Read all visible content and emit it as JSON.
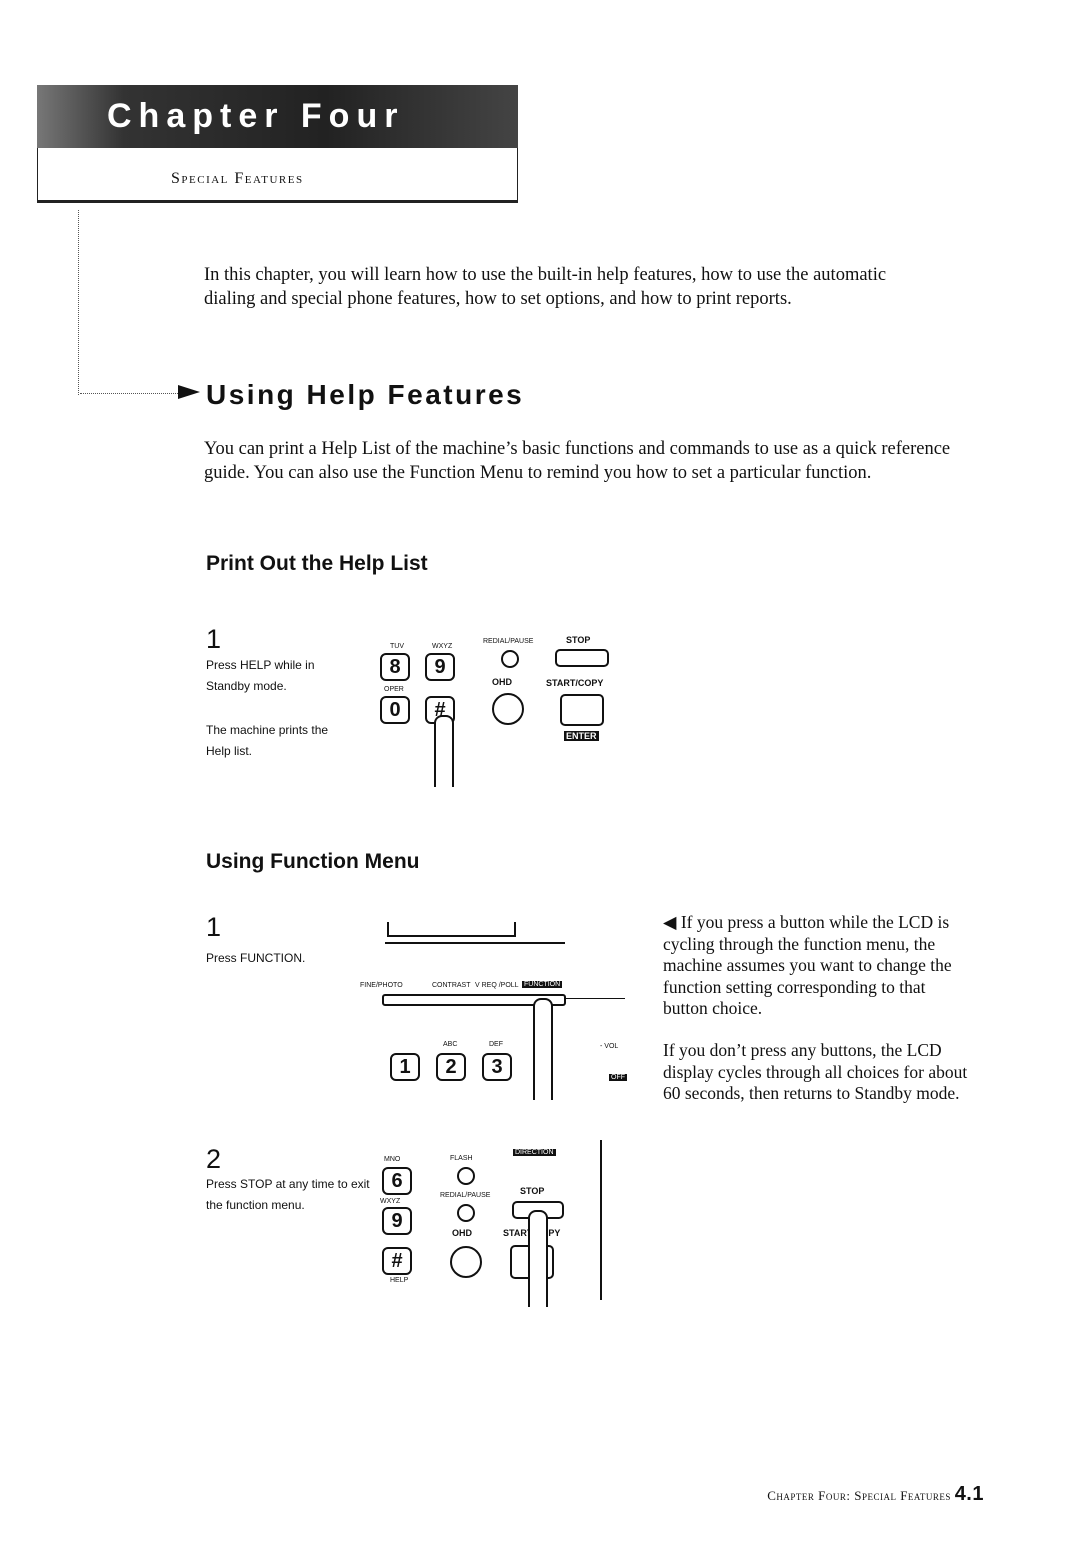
{
  "header": {
    "chapter": "Chapter Four",
    "subtitle": "Special Features"
  },
  "intro": "In this chapter, you will learn how to use the built-in help features, how to use the automatic dialing and special phone features, how to set options, and how to print reports.",
  "section": {
    "title": "Using Help Features",
    "body": "You can print a Help List of the machine’s basic functions and commands to use as a quick reference guide. You can also use the Function Menu to remind you how to set a particular function."
  },
  "help_list": {
    "title": "Print Out the Help List",
    "step_number": "1",
    "step_text_1": "Press HELP while in Standby mode.",
    "step_text_2": "The machine prints the Help list.",
    "panel": {
      "keys": [
        "8",
        "9",
        "0",
        "#"
      ],
      "key_labels": [
        "TUV",
        "WXYZ",
        "OPER"
      ],
      "redial": "REDIAL/PAUSE",
      "ohd": "OHD",
      "stop": "STOP",
      "start": "START/COPY",
      "enter": "ENTER"
    }
  },
  "function_menu": {
    "title": "Using Function Menu",
    "step1_number": "1",
    "step1_text": "Press FUNCTION.",
    "step2_number": "2",
    "step2_text": "Press STOP at any time to exit the function menu.",
    "panel1": {
      "buttons": [
        "FINE/PHOTO",
        "CONTRAST",
        "V REQ /POLL",
        "FUNCTION"
      ],
      "keys": [
        "1",
        "2",
        "3"
      ],
      "key_labels": [
        "ABC",
        "DEF"
      ],
      "vol": "- VOL",
      "off": "OFF"
    },
    "panel2": {
      "keys": [
        "6",
        "9",
        "#"
      ],
      "key_labels": [
        "MNO",
        "WXYZ",
        "HELP"
      ],
      "flash": "FLASH",
      "redial": "REDIAL/PAUSE",
      "ohd": "OHD",
      "stop": "STOP",
      "start": "START/COPY",
      "direction": "DIRECTION"
    },
    "note1": "If you press a button while the LCD is cycling through the function menu, the machine assumes you want to change the function setting corresponding to that button choice.",
    "note2": "If you don’t press any buttons, the LCD display cycles through all choices for about 60 seconds, then returns to Standby mode."
  },
  "footer": {
    "text": "Chapter Four: Special Features",
    "page": "4.1"
  }
}
